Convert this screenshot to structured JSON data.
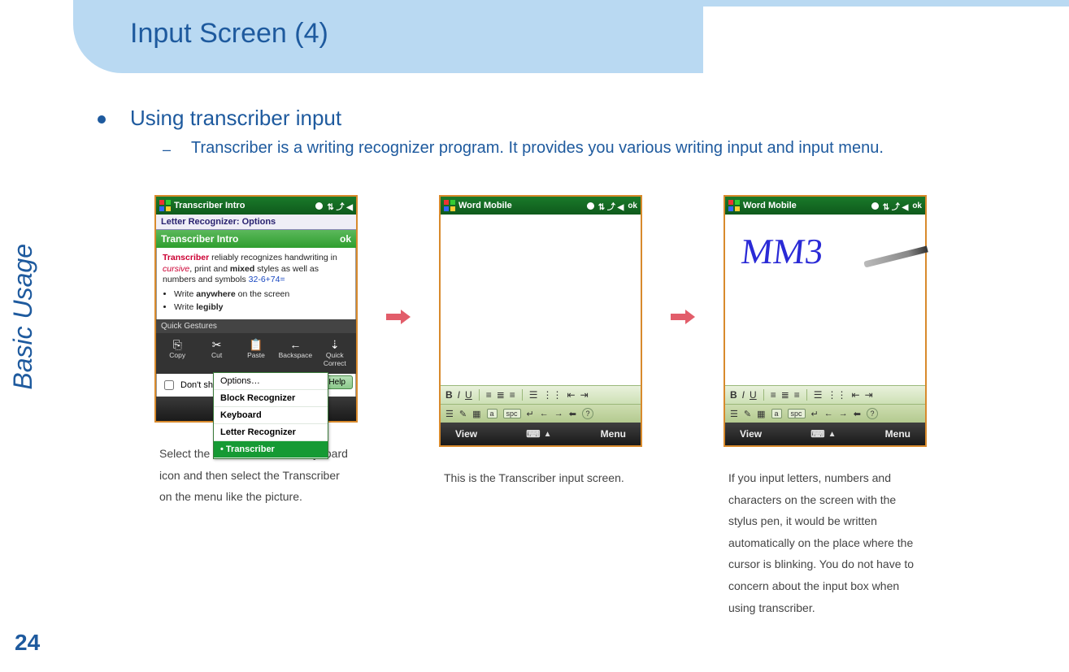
{
  "page": {
    "title": "Input Screen (4)",
    "side_label": "Basic Usage",
    "number": "24"
  },
  "bullet": {
    "heading": "Using transcriber input",
    "sub": "Transcriber is a writing recognizer program. It provides you various writing input and input menu."
  },
  "captions": {
    "c1": "Select the arrow next to the keyboard icon and then select the Transcriber on the menu like the picture.",
    "c2": "This is the Transcriber input screen.",
    "c3": "If you input  letters, numbers and characters on the screen with the stylus pen, it would be written automatically on the place where the cursor is blinking. You do not have to concern about the input  box when using transcriber."
  },
  "phone1": {
    "titlebar": "Transcriber Intro",
    "subbar": "Letter Recognizer: Options",
    "greenbar_title": "Transcriber Intro",
    "greenbar_ok": "ok",
    "intro_line1a": "Transcriber",
    "intro_line1b": " reliably recognizes handwriting in ",
    "intro_line1c": "cursive",
    "intro_line1d": ", print",
    "intro_line1e": " and ",
    "intro_line1f": "mixed",
    "intro_line1g": " styles as well as numbers and symbols ",
    "intro_line1h": "32-6+74=",
    "bul1a": "Write ",
    "bul1b": "anywhere",
    "bul1c": " on the screen",
    "bul2a": "Write ",
    "bul2b": "legibly",
    "gestures_label": "Quick Gestures",
    "g1": "Copy",
    "g2": "Cut",
    "g3": "Paste",
    "g4": "Backspace",
    "g5": "Quick Correct",
    "dontshow": "Don't sh",
    "help": "Help",
    "menu": {
      "o1": "Options…",
      "o2": "Block Recognizer",
      "o3": "Keyboard",
      "o4": "Letter Recognizer",
      "o5": "Transcriber"
    }
  },
  "phone23": {
    "titlebar": "Word Mobile",
    "ok": "ok",
    "view": "View",
    "menu": "Menu",
    "handwriting": "MM3",
    "fmt": {
      "b": "B",
      "i": "I",
      "u": "U"
    },
    "t2": {
      "a": "a",
      "spc": "spc",
      "enter": "↵",
      "left": "←",
      "right": "→",
      "back": "⬅",
      "help": "?"
    }
  }
}
